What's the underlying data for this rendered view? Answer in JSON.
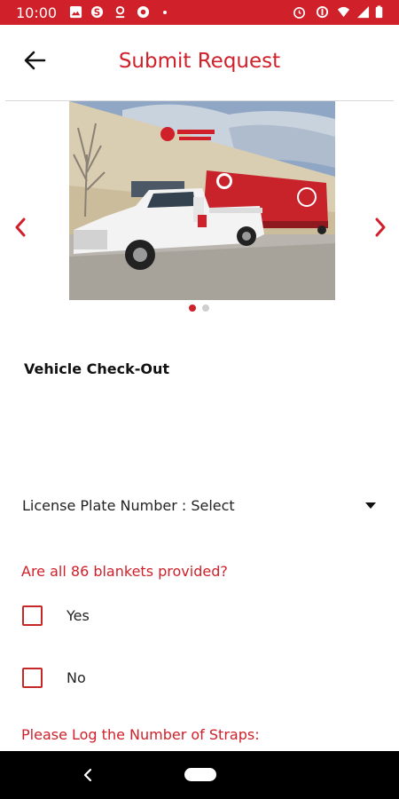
{
  "status_bar": {
    "time": "10:00",
    "background": "#d0202a"
  },
  "header": {
    "title": "Submit Request",
    "back_icon": "arrow-left-icon",
    "accent": "#d0202a"
  },
  "carousel": {
    "prev_icon": "chevron-left-icon",
    "next_icon": "chevron-right-icon",
    "image_description_icon": "vehicle-photo",
    "slides": 2,
    "active_slide": 1
  },
  "form": {
    "section_title": "Vehicle Check-Out",
    "license_select_label": "License Plate Number : Select",
    "question_blankets": "Are all 86 blankets provided?",
    "option_yes": "Yes",
    "option_no": "No",
    "question_straps": "Please Log the Number of Straps:"
  },
  "nav_bar": {
    "back_icon": "triangle-back-icon",
    "home_icon": "pill-home-icon"
  }
}
